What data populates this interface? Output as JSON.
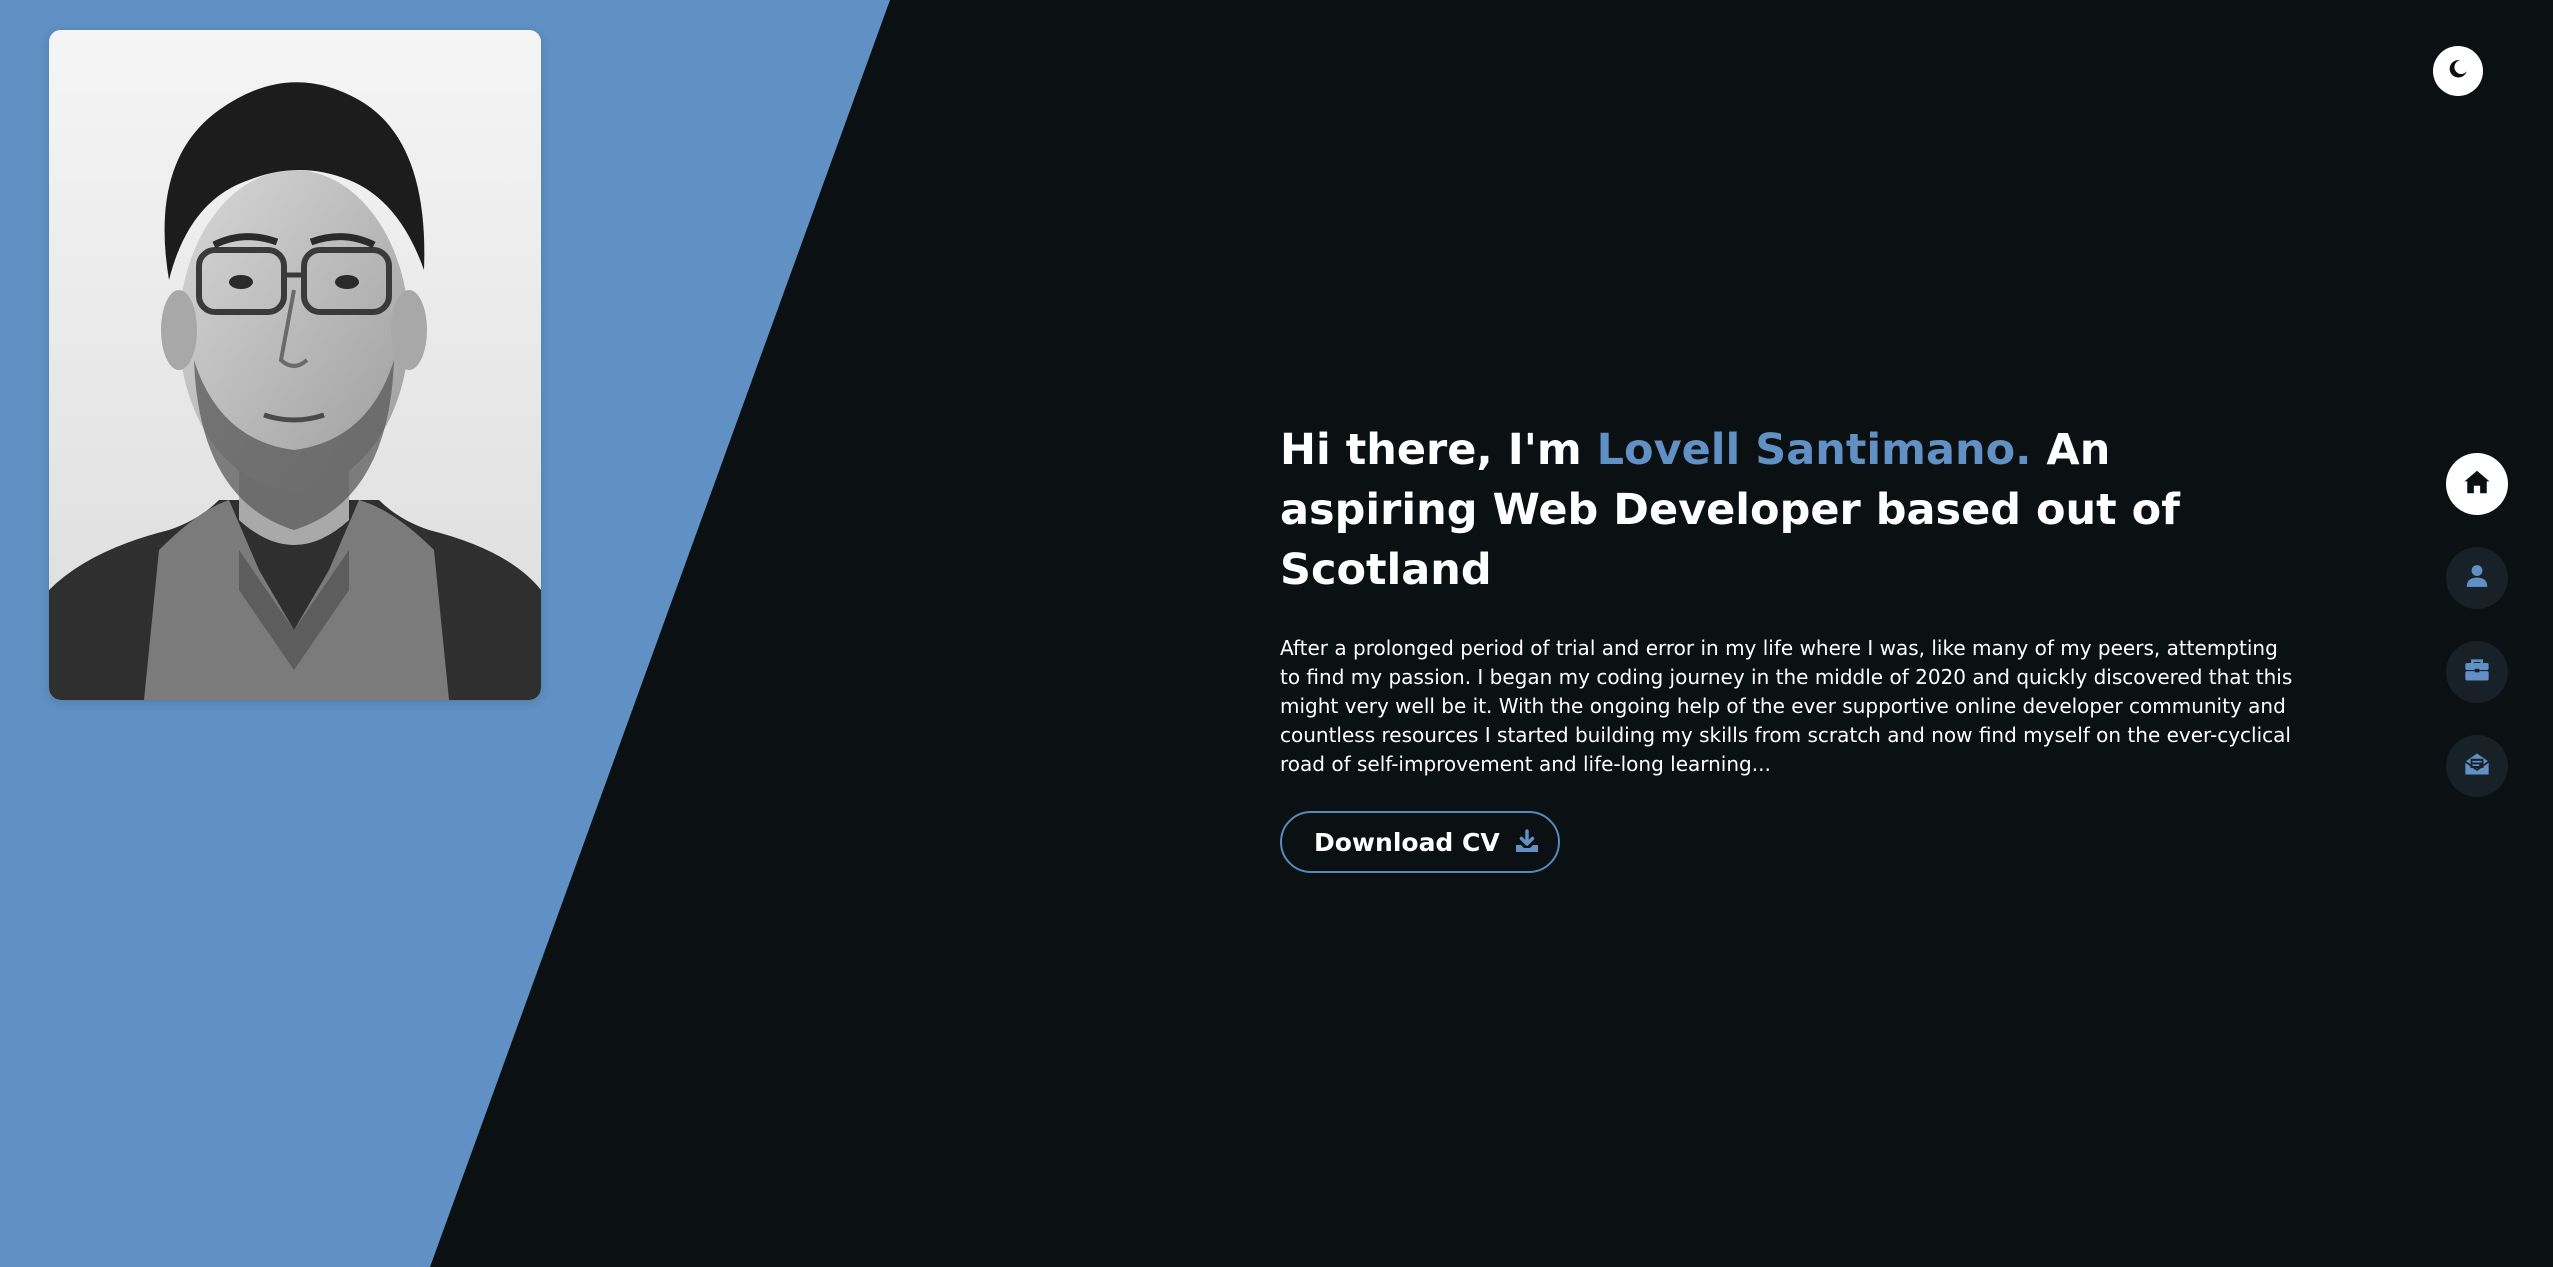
{
  "colors": {
    "background": "#0b1012",
    "accent": "#6090c4",
    "text": "#ffffff",
    "nav_inactive": "#182028",
    "nav_active": "#ffffff"
  },
  "portrait": {
    "alt": "Black and white portrait of a man with glasses"
  },
  "theme_toggle": {
    "icon": "moon-icon"
  },
  "hero": {
    "title_prefix": "Hi there, I'm ",
    "name": "Lovell Santimano.",
    "title_suffix": " An aspiring Web Developer based out of Scotland",
    "description": "After a prolonged period of trial and error in my life where I was, like many of my peers, attempting to find my passion. I began my coding journey in the middle of 2020 and quickly discovered that this might very well be it. With the ongoing help of the ever supportive online developer community and countless resources I started building my skills from scratch and now find myself on the ever-cyclical road of self-improvement and life-long learning...",
    "cv_button_label": "Download CV",
    "cv_button_icon": "download-icon"
  },
  "nav": {
    "items": [
      {
        "icon": "home-icon",
        "active": true
      },
      {
        "icon": "user-icon",
        "active": false
      },
      {
        "icon": "briefcase-icon",
        "active": false
      },
      {
        "icon": "mail-icon",
        "active": false
      }
    ]
  }
}
